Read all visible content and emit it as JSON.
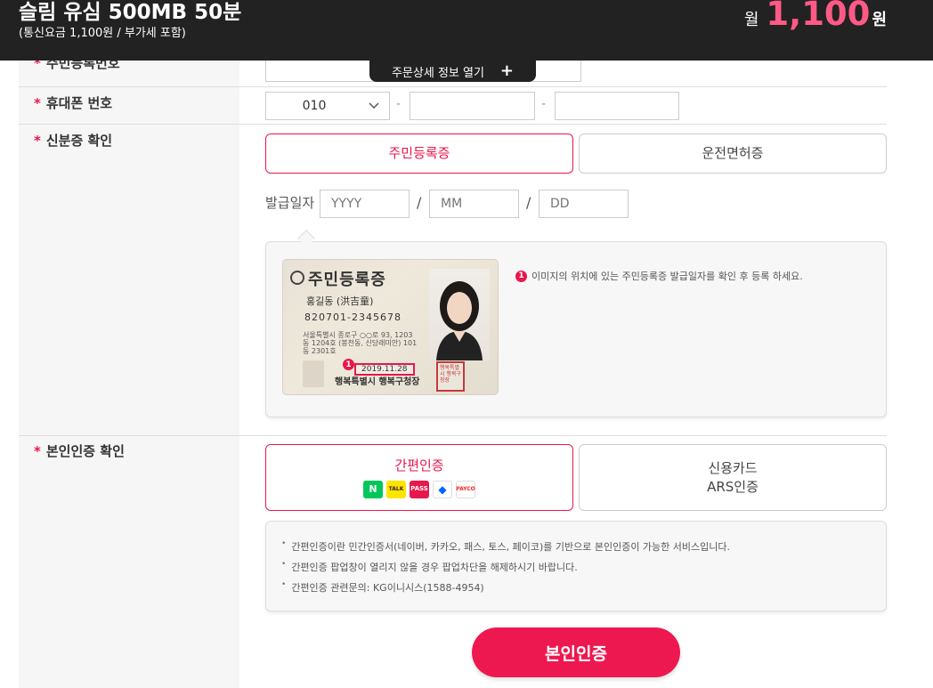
{
  "header": {
    "plan_name": "슬림 유심 500MB 50분",
    "plan_sub": "(통신요금 1,100원 / 부가세 포함)",
    "price_prefix": "월",
    "price_amount": "1,100",
    "price_suffix": "원"
  },
  "detail_toggle": {
    "label": "주문상세 정보 열기",
    "icon": "plus-icon"
  },
  "fields": {
    "resident_number": {
      "label": "주민등록번호"
    },
    "phone": {
      "label": "휴대폰 번호",
      "prefix_value": "010",
      "separator": "-"
    },
    "id_check": {
      "label": "신분증 확인",
      "options": [
        "주민등록증",
        "운전면허증"
      ],
      "selected": "주민등록증",
      "issue_date_label": "발급일자",
      "year_placeholder": "YYYY",
      "month_placeholder": "MM",
      "day_placeholder": "DD",
      "date_separator": "/",
      "card": {
        "title": "주민등록증",
        "name": "홍길동 (洪吉童)",
        "number": "820701-2345678",
        "address": "서울특별시 종로구 ○○로 93, 1203동 1204호 (봉천동, 신당래미안) 101동 2301호",
        "issue_date": "2019.11.28",
        "issuer": "행복특별시 행복구청장",
        "seal": "행복특별시 행복구청장",
        "badge": "1"
      },
      "hint_badge": "1",
      "hint_text": "이미지의 위치에 있는 주민등록증 발급일자를 확인 후 등록 하세요."
    },
    "auth": {
      "label": "본인인증 확인",
      "option_simple": "간편인증",
      "option_card_line1": "신용카드",
      "option_card_line2": "ARS인증",
      "icons": [
        "N",
        "TALK",
        "PASS",
        "toss",
        "PAYCO"
      ],
      "notices": [
        "간편인증이란 민간인증서(네이버, 카카오, 패스, 토스, 페이코)를 기반으로 본인인증이 가능한 서비스입니다.",
        "간편인증 팝업창이 열리지 않을 경우 팝업차단을 해제하시기 바랍니다.",
        "간편인증 관련문의: KG이니시스(1588-4954)"
      ]
    }
  },
  "submit_label": "본인인증",
  "colors": {
    "accent": "#e8174c",
    "header_bg": "#222222",
    "price": "#ff5a86"
  }
}
